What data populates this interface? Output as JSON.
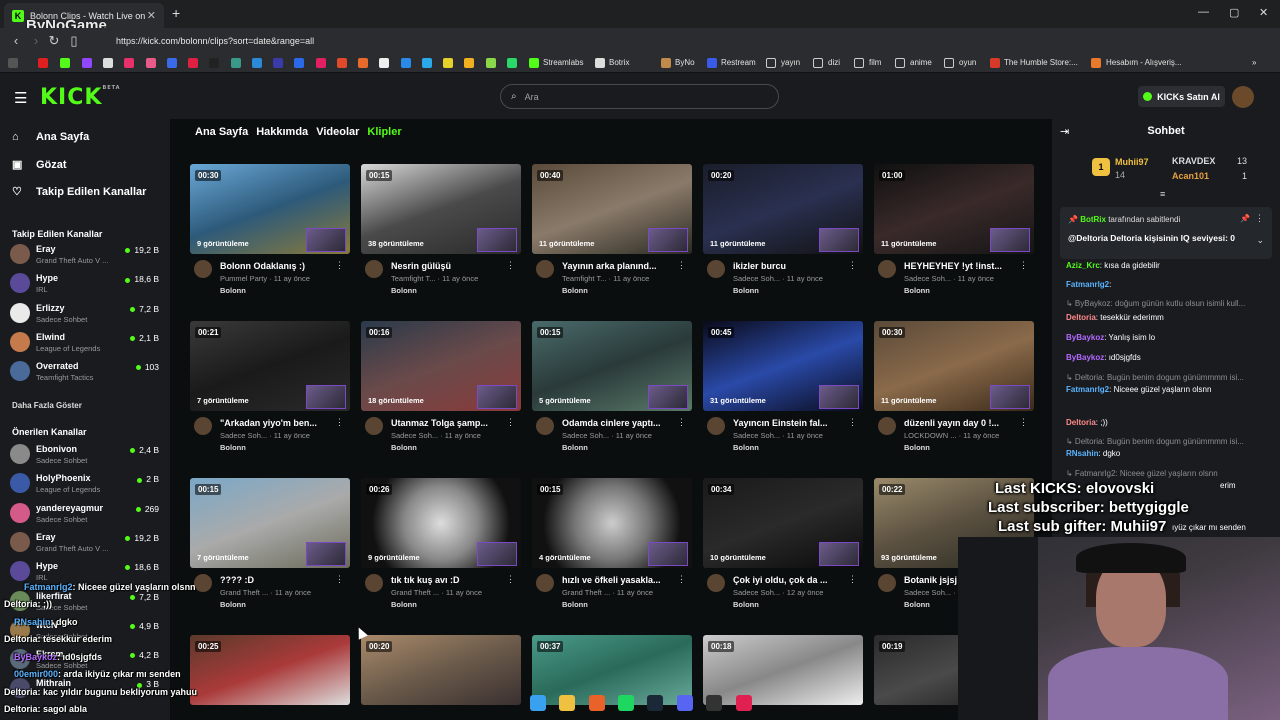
{
  "browser": {
    "tab_title": "Bolonn Clips - Watch Live on Kick",
    "tab_close": "✕",
    "new_tab": "+",
    "url": "https://kick.com/bolonn/clips?sort=date&range=all",
    "watermark": "ByNoGame",
    "window_controls": [
      "—",
      "▢",
      "✕"
    ]
  },
  "bookmarks": [
    {
      "label": "Streamlabs"
    },
    {
      "label": "Botrix"
    },
    {
      "label": "ByNo"
    },
    {
      "label": "Restream"
    },
    {
      "label": "yayın"
    },
    {
      "label": "dizi"
    },
    {
      "label": "film"
    },
    {
      "label": "anime"
    },
    {
      "label": "oyun"
    },
    {
      "label": "The Humble Store:..."
    },
    {
      "label": "Hesabım - Alışveriş..."
    }
  ],
  "header": {
    "logo": "KICK",
    "logo_badge": "BETA",
    "search_placeholder": "Ara",
    "buy_kicks": "KICKs Satın Al"
  },
  "sidebar": {
    "nav": [
      {
        "label": "Ana Sayfa",
        "icon": "home-icon"
      },
      {
        "label": "Gözat",
        "icon": "browse-icon"
      },
      {
        "label": "Takip Edilen Kanallar",
        "icon": "heart-icon"
      }
    ],
    "followed_heading": "Takip Edilen Kanallar",
    "followed": [
      {
        "name": "Eray",
        "category": "Grand Theft Auto V ...",
        "viewers": "19,2 B",
        "color": "#7a5a4a"
      },
      {
        "name": "Hype",
        "category": "IRL",
        "viewers": "18,6 B",
        "color": "#5b4a9a"
      },
      {
        "name": "Erlizzy",
        "category": "Sadece Sohbet",
        "viewers": "7,2 B",
        "color": "#eaeaea"
      },
      {
        "name": "Elwind",
        "category": "League of Legends",
        "viewers": "2,1 B",
        "color": "#c47a4a"
      },
      {
        "name": "Overrated",
        "category": "Teamfight Tactics",
        "viewers": "103",
        "color": "#4a6a9a"
      }
    ],
    "show_more": "Daha Fazla Göster",
    "recommended_heading": "Önerilen Kanallar",
    "recommended": [
      {
        "name": "Ebonivon",
        "category": "Sadece Sohbet",
        "viewers": "2,4 B",
        "color": "#8a8a8a"
      },
      {
        "name": "HolyPhoenix",
        "category": "League of Legends",
        "viewers": "2 B",
        "color": "#3a5aa8"
      },
      {
        "name": "yandereyagmur",
        "category": "Sadece Sohbet",
        "viewers": "269",
        "color": "#d45a8a"
      },
      {
        "name": "Eray",
        "category": "Grand Theft Auto V ...",
        "viewers": "19,2 B",
        "color": "#7a5a4a"
      },
      {
        "name": "Hype",
        "category": "IRL",
        "viewers": "18,6 B",
        "color": "#5b4a9a"
      },
      {
        "name": "likerfirat",
        "category": "Sadece Sohbet",
        "viewers": "7,2 B",
        "color": "#6a8a5a"
      },
      {
        "name": "wtcN",
        "category": "Sadece Sohbet",
        "viewers": "4,9 B",
        "color": "#9a7a4a"
      },
      {
        "name": "Ekrem",
        "category": "Sadece Sohbet",
        "viewers": "4,2 B",
        "color": "#5a6a7a"
      },
      {
        "name": "Mithrain",
        "category": "",
        "viewers": "3 B",
        "color": "#4a4a6a"
      }
    ]
  },
  "main": {
    "tabs": [
      {
        "label": "Ana Sayfa",
        "active": false
      },
      {
        "label": "Hakkımda",
        "active": false
      },
      {
        "label": "Videolar",
        "active": false
      },
      {
        "label": "Klipler",
        "active": true
      }
    ],
    "clips": [
      {
        "duration": "00:30",
        "views": "9 görüntüleme",
        "title": "Bolonn Odaklanış :)",
        "sub": "Pummel Party · 11 ay önce",
        "by": "Bolonn",
        "bg": "linear-gradient(160deg,#6aa8d8,#2d5a7a 50%,#8a7a3a)"
      },
      {
        "duration": "00:15",
        "views": "38 görüntüleme",
        "title": "Nesrin gülüşü",
        "sub": "Teamfight T... · 11 ay önce",
        "by": "Bolonn",
        "bg": "linear-gradient(160deg,#d8d8d8,#4a4a4a 50%,#2a2a2a)"
      },
      {
        "duration": "00:40",
        "views": "11 görüntüleme",
        "title": "Yayının arka planınd...",
        "sub": "Teamfight T... · 11 ay önce",
        "by": "Bolonn",
        "bg": "linear-gradient(160deg,#5a4a3a,#8a7a6a 50%,#2a2a22)"
      },
      {
        "duration": "00:20",
        "views": "11 görüntüleme",
        "title": "ikizler burcu",
        "sub": "Sadece Soh... · 11 ay önce",
        "by": "Bolonn",
        "bg": "linear-gradient(160deg,#1a1d2a,#2a3050 50%,#111)"
      },
      {
        "duration": "01:00",
        "views": "11 görüntüleme",
        "title": "HEYHEYHEY !yt !inst...",
        "sub": "Sadece Soh... · 11 ay önce",
        "by": "Bolonn",
        "bg": "linear-gradient(160deg,#101010,#3a2a2a 50%,#151515)"
      },
      {
        "duration": "00:21",
        "views": "7 görüntüleme",
        "title": "\"Arkadan yiyo'm ben...",
        "sub": "Sadece Soh... · 11 ay önce",
        "by": "Bolonn",
        "bg": "linear-gradient(160deg,#3a3a3a,#1a1a1a 50%,#2a2a2a)"
      },
      {
        "duration": "00:16",
        "views": "18 görüntüleme",
        "title": "Utanmaz Tolga şamp...",
        "sub": "Sadece Soh... · 11 ay önce",
        "by": "Bolonn",
        "bg": "linear-gradient(160deg,#2a3a4a,#6a4a4a 50%,#8a3a3a)"
      },
      {
        "duration": "00:15",
        "views": "5 görüntüleme",
        "title": "Odamda cinlere yaptı...",
        "sub": "Sadece Soh... · 11 ay önce",
        "by": "Bolonn",
        "bg": "linear-gradient(160deg,#4a6a6a,#2a3a3a 50%,#5a7a6a)"
      },
      {
        "duration": "00:45",
        "views": "31 görüntüleme",
        "title": "Yayıncın Einstein fal...",
        "sub": "Sadece Soh... · 11 ay önce",
        "by": "Bolonn",
        "bg": "linear-gradient(160deg,#0a0a1a,#2a4aa8 50%,#0a0a1a)"
      },
      {
        "duration": "00:30",
        "views": "11 görüntüleme",
        "title": "düzenli yayın day 0 !...",
        "sub": "LOCKDOWN ... · 11 ay önce",
        "by": "Bolonn",
        "bg": "linear-gradient(160deg,#5a4a3a,#8a6a4a 50%,#3a2a1a)"
      },
      {
        "duration": "00:15",
        "views": "7 görüntüleme",
        "title": "???? :D",
        "sub": "Grand Theft ... · 11 ay önce",
        "by": "Bolonn",
        "bg": "linear-gradient(160deg,#7aa8c8,#aaa 50%,#6a6a5a)"
      },
      {
        "duration": "00:26",
        "views": "9 görüntüleme",
        "title": "tık tık kuş avı :D",
        "sub": "Grand Theft ... · 11 ay önce",
        "by": "Bolonn",
        "bg": "radial-gradient(circle at 50% 50%,#ddd,#888 40%,#111 75%)"
      },
      {
        "duration": "00:15",
        "views": "4 görüntüleme",
        "title": "hızlı ve öfkeli yasakla...",
        "sub": "Grand Theft ... · 11 ay önce",
        "by": "Bolonn",
        "bg": "radial-gradient(circle at 50% 50%,#ccc,#777 40%,#111 75%)"
      },
      {
        "duration": "00:34",
        "views": "10 görüntüleme",
        "title": "Çok iyi oldu, çok da ...",
        "sub": "Sadece Soh... · 12 ay önce",
        "by": "Bolonn",
        "bg": "linear-gradient(160deg,#1a1a1a,#2a2a2a 50%,#0a0a0a)"
      },
      {
        "duration": "00:22",
        "views": "93 görüntüleme",
        "title": "Botanik jsjsj",
        "sub": "Sadece Soh... · 12 ay önce",
        "by": "Bolonn",
        "bg": "linear-gradient(160deg,#9a8a6a,#5a5040 50%,#2a2a22)"
      },
      {
        "duration": "00:25",
        "views": "",
        "title": "",
        "sub": "",
        "by": "",
        "bg": "linear-gradient(160deg,#5a3a2a,#aa3a3a 50%,#ddd)"
      },
      {
        "duration": "00:20",
        "views": "",
        "title": "",
        "sub": "",
        "by": "",
        "bg": "linear-gradient(160deg,#aa8a6a,#6a5a4a 50%,#3a3030)"
      },
      {
        "duration": "00:37",
        "views": "",
        "title": "",
        "sub": "",
        "by": "",
        "bg": "linear-gradient(160deg,#4a9a8a,#2a6a5a 50%,#6aaa9a)"
      },
      {
        "duration": "00:18",
        "views": "",
        "title": "",
        "sub": "",
        "by": "",
        "bg": "linear-gradient(160deg,#ccc,#888 50%,#eee)"
      },
      {
        "duration": "00:19",
        "views": "",
        "title": "",
        "sub": "",
        "by": "",
        "bg": "linear-gradient(160deg,#2a2a2a,#4a4a4a 50%,#1a1a1a)"
      }
    ]
  },
  "chat": {
    "title": "Sohbet",
    "gifters": [
      {
        "name": "Muhii97",
        "count": "14",
        "color": "#f0c040"
      },
      {
        "name": "KRAVDEX",
        "count": "13",
        "color": "#ddd"
      },
      {
        "name": "Acan101",
        "count": "1",
        "color": "#e8a040"
      }
    ],
    "pinned_by": "BotRix",
    "pinned_by_suffix": "tarafından sabitlendi",
    "pinned_text": "@Deltoria Deltoria kişisinin IQ seviyesi: 0",
    "messages": [
      {
        "user": "Aziz_Krc",
        "text": ": kısa da gidebilir",
        "color": "#53fc18",
        "sys": false
      },
      {
        "user": "Fatmanrlg2",
        "text": ":",
        "color": "#5ab4ff",
        "sys": false
      },
      {
        "user": "",
        "text": "↳ ByBaykoz: doğum günün kutlu olsun isimli kull...",
        "color": "",
        "sys": true
      },
      {
        "user": "Deltoria",
        "text": ": tesekkür ederimm",
        "color": "#ff8a8a",
        "sys": false
      },
      {
        "user": "ByBaykoz",
        "text": ": Yanlış isim lo",
        "color": "#b46aff",
        "sys": false
      },
      {
        "user": "ByBaykoz",
        "text": ": ıd0sjgfds",
        "color": "#b46aff",
        "sys": false
      },
      {
        "user": "",
        "text": "↳ Deltoria: Bugün benim dogum günümmmm isi...",
        "color": "",
        "sys": true
      },
      {
        "user": "Fatmanrlg2",
        "text": ": Niceee güzel yaşların olsnn",
        "color": "#5ab4ff",
        "sys": false
      },
      {
        "user": "Deltoria",
        "text": ": ;))",
        "color": "#ff8a8a",
        "sys": false
      },
      {
        "user": "",
        "text": "↳ Deltoria: Bugün benim dogum günümmmm isi...",
        "color": "",
        "sys": true
      },
      {
        "user": "RNsahin",
        "text": ": dgko",
        "color": "#5ab4ff",
        "sys": false
      },
      {
        "user": "",
        "text": "↳ Fatmanrlg2: Niceee güzel yaşların olsnn",
        "color": "",
        "sys": true
      },
      {
        "user": "",
        "text": "erim",
        "color": "",
        "sys": false
      },
      {
        "user": "",
        "text": "ıyüz çıkar mı senden",
        "color": "",
        "sys": false
      }
    ]
  },
  "stream_overlay": {
    "last_kicks": "Last KICKS: elovovski",
    "last_sub": "Last subscriber: bettygiggle",
    "last_gifter": "Last sub gifter: Muhii97",
    "chat": [
      {
        "user": "Fatmanrlg2",
        "text": ": Niceee güzel yaşların olsnn"
      },
      {
        "user": "Deltoria",
        "text": ": ;))"
      },
      {
        "user": "RNsahin",
        "text": ": dgko"
      },
      {
        "user": "Deltoria",
        "text": ": tesekkur ederim"
      },
      {
        "user": "ByBaykoz",
        "text": ": ıd0sjgfds"
      },
      {
        "user": "00emir000",
        "text": ": arda ikiyüz çıkar mı senden"
      },
      {
        "user": "Deltoria",
        "text": ": kac yıldır bugunu bekliyorum yahuu"
      },
      {
        "user": "Deltoria",
        "text": ": sagol abla"
      }
    ]
  },
  "taskbar": [
    "windows-start-icon",
    "file-explorer-icon",
    "brave-icon",
    "spotify-icon",
    "steam-icon",
    "discord-icon",
    "obs-icon",
    "kick-taskbar-icon"
  ]
}
